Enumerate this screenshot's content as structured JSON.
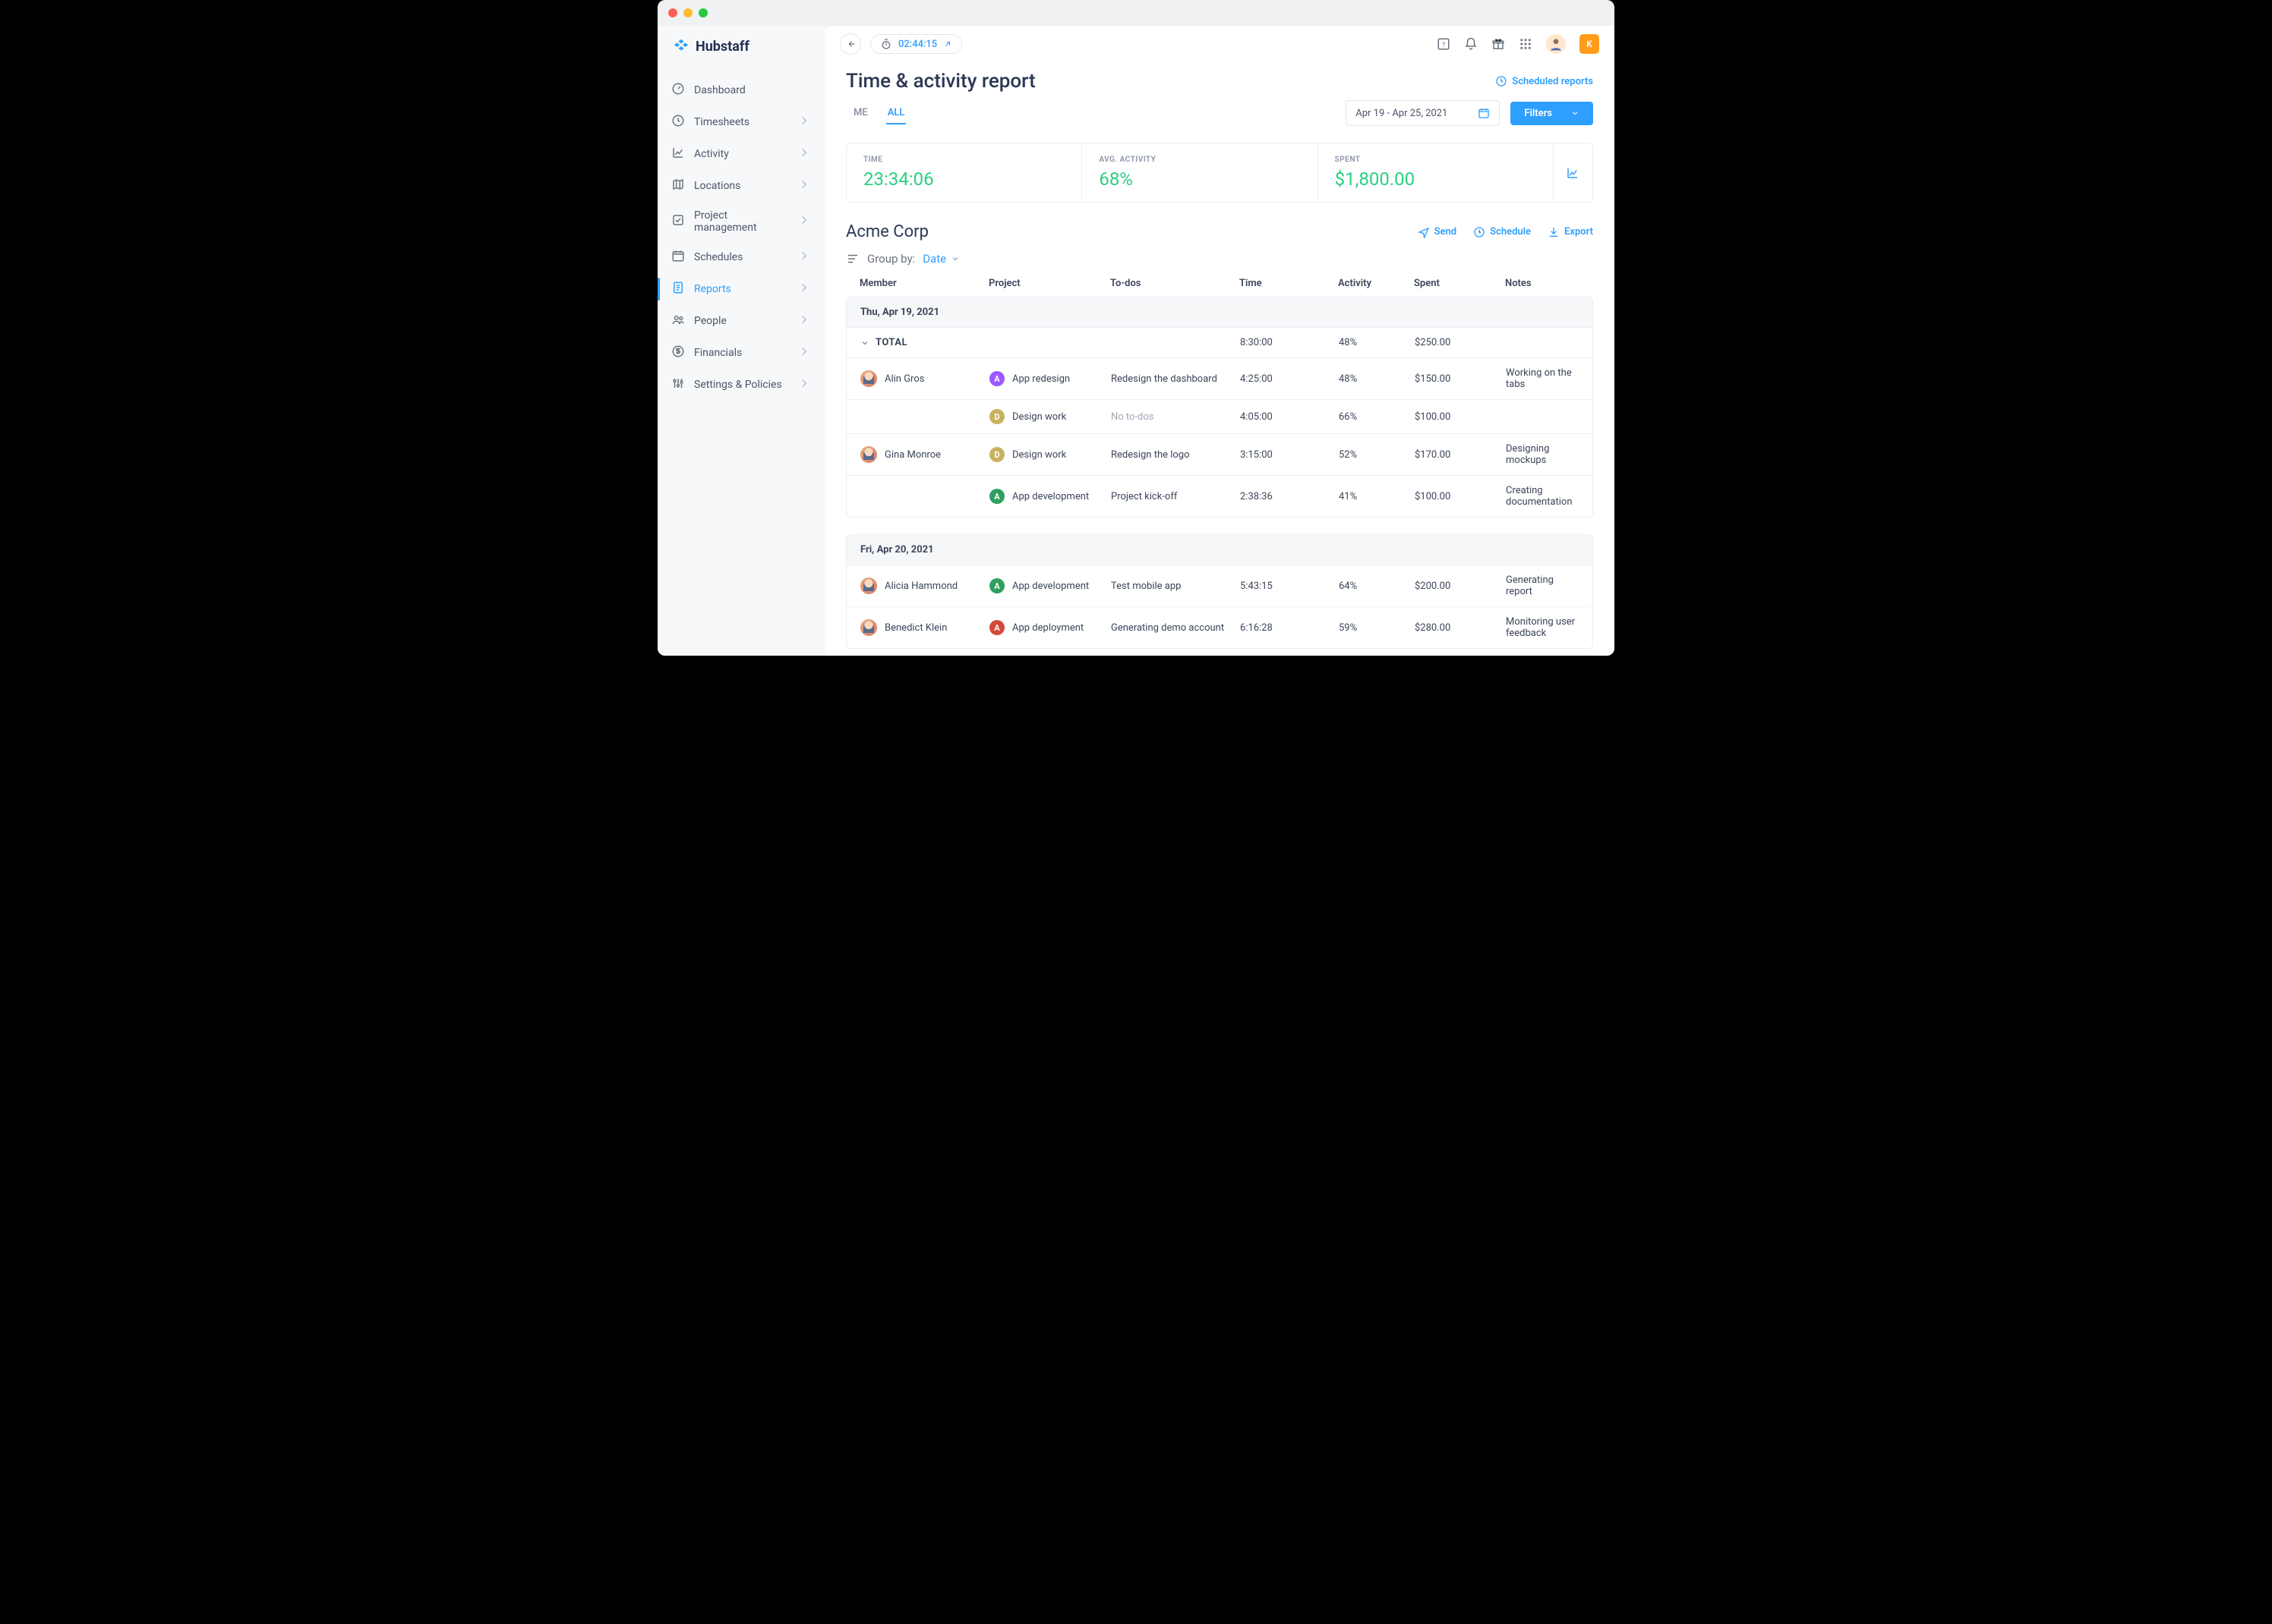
{
  "app_name": "Hubstaff",
  "timer": "02:44:15",
  "topbar_user_initial": "K",
  "sidebar": [
    {
      "icon": "dashboard",
      "label": "Dashboard",
      "chev": false
    },
    {
      "icon": "clock",
      "label": "Timesheets",
      "chev": true
    },
    {
      "icon": "activity",
      "label": "Activity",
      "chev": true
    },
    {
      "icon": "map",
      "label": "Locations",
      "chev": true
    },
    {
      "icon": "check",
      "label": "Project management",
      "chev": true
    },
    {
      "icon": "calendar",
      "label": "Schedules",
      "chev": true
    },
    {
      "icon": "report",
      "label": "Reports",
      "chev": true,
      "active": true
    },
    {
      "icon": "people",
      "label": "People",
      "chev": true
    },
    {
      "icon": "dollar",
      "label": "Financials",
      "chev": true
    },
    {
      "icon": "sliders",
      "label": "Settings & Policies",
      "chev": true
    }
  ],
  "page_title": "Time & activity report",
  "scheduled_reports_label": "Scheduled reports",
  "tabs": {
    "me": "ME",
    "all": "ALL"
  },
  "date_range": "Apr 19 - Apr 25, 2021",
  "filters_label": "Filters",
  "summary": {
    "time_label": "TIME",
    "time_value": "23:34:06",
    "activity_label": "AVG. ACTIVITY",
    "activity_value": "68%",
    "spent_label": "SPENT",
    "spent_value": "$1,800.00"
  },
  "org_name": "Acme Corp",
  "actions": {
    "send": "Send",
    "schedule": "Schedule",
    "export": "Export"
  },
  "groupby": {
    "label": "Group by:",
    "value": "Date"
  },
  "columns": {
    "member": "Member",
    "project": "Project",
    "todos": "To-dos",
    "time": "Time",
    "activity": "Activity",
    "spent": "Spent",
    "notes": "Notes"
  },
  "total_label": "TOTAL",
  "days": [
    {
      "title": "Thu, Apr 19, 2021",
      "total": {
        "time": "8:30:00",
        "activity": "48%",
        "spent": "$250.00"
      },
      "rows": [
        {
          "member": "Alin Gros",
          "show_member": true,
          "avatar": "person",
          "project": "App redesign",
          "proj_color": "#9b59ff",
          "proj_letter": "A",
          "todo": "Redesign the dashboard",
          "time": "4:25:00",
          "activity": "48%",
          "spent": "$150.00",
          "notes": "Working on the tabs"
        },
        {
          "member": "",
          "show_member": false,
          "avatar": "",
          "project": "Design work",
          "proj_color": "#c9b25f",
          "proj_letter": "D",
          "todo": "No to-dos",
          "todo_muted": true,
          "time": "4:05:00",
          "activity": "66%",
          "spent": "$100.00",
          "notes": ""
        },
        {
          "member": "Gina Monroe",
          "show_member": true,
          "avatar": "person",
          "project": "Design work",
          "proj_color": "#c9b25f",
          "proj_letter": "D",
          "todo": "Redesign the logo",
          "time": "3:15:00",
          "activity": "52%",
          "spent": "$170.00",
          "notes": "Designing mockups"
        },
        {
          "member": "",
          "show_member": false,
          "avatar": "",
          "project": "App development",
          "proj_color": "#2f9e5e",
          "proj_letter": "A",
          "todo": "Project kick-off",
          "time": "2:38:36",
          "activity": "41%",
          "spent": "$100.00",
          "notes": "Creating documentation"
        }
      ]
    },
    {
      "title": "Fri, Apr 20, 2021",
      "rows": [
        {
          "member": "Alicia Hammond",
          "show_member": true,
          "avatar": "person",
          "project": "App development",
          "proj_color": "#2f9e5e",
          "proj_letter": "A",
          "todo": "Test mobile app",
          "time": "5:43:15",
          "activity": "64%",
          "spent": "$200.00",
          "notes": "Generating report"
        },
        {
          "member": "Benedict Klein",
          "show_member": true,
          "avatar": "person",
          "project": "App deployment",
          "proj_color": "#d44a3a",
          "proj_letter": "A",
          "todo": "Generating demo account",
          "time": "6:16:28",
          "activity": "59%",
          "spent": "$280.00",
          "notes": "Monitoring user feedback"
        }
      ]
    }
  ]
}
